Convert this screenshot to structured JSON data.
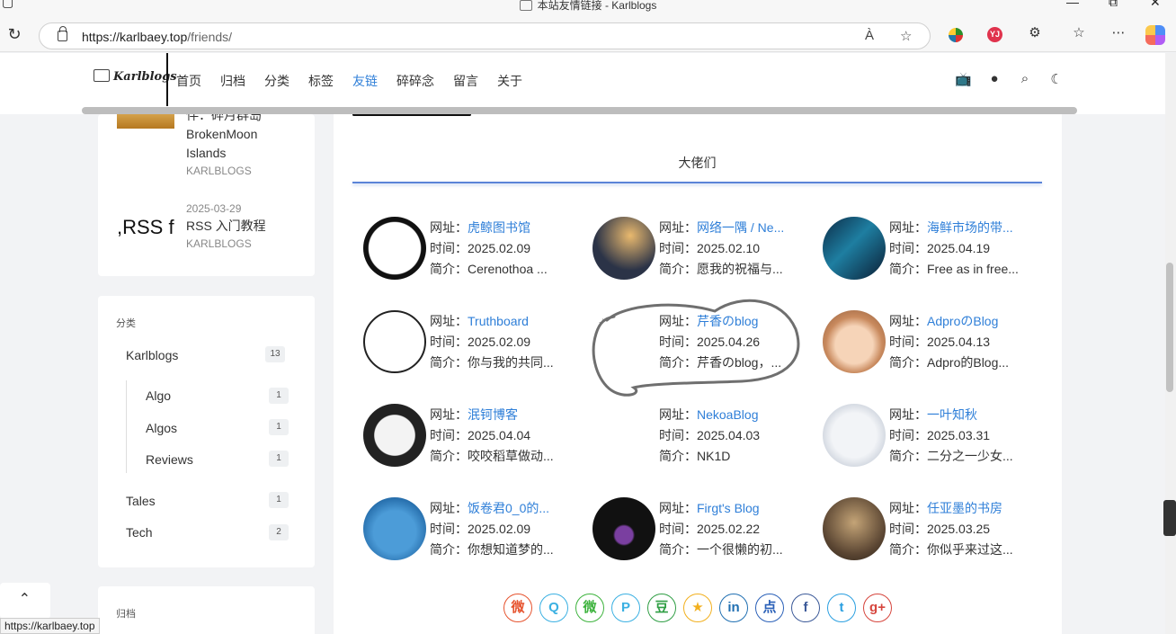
{
  "browser": {
    "window_title": "本站友情链接 - Karlblogs",
    "url_host": "https://karlbaey.top",
    "url_path": "/friends/",
    "read_aloud_icon": "À",
    "ext_badge": "YJ",
    "status_url": "https://karlbaey.top"
  },
  "site": {
    "logo_text": "Karlblogs",
    "nav": [
      {
        "label": "首页"
      },
      {
        "label": "归档"
      },
      {
        "label": "分类"
      },
      {
        "label": "标签"
      },
      {
        "label": "友链"
      },
      {
        "label": "碎碎念"
      },
      {
        "label": "留言"
      },
      {
        "label": "关于"
      }
    ]
  },
  "sidebar": {
    "recent_posts": [
      {
        "title_partial": "伴：碎月群岛",
        "title_line2": "BrokenMoon",
        "title_line3": "Islands",
        "author": "KARLBLOGS"
      },
      {
        "date": "2025-03-29",
        "title": "RSS 入门教程",
        "author": "KARLBLOGS",
        "thumb_text": ",RSS fe"
      }
    ],
    "categories_title": "分类",
    "categories": [
      {
        "name": "Karlblogs",
        "count": "13"
      },
      {
        "name": "Algo",
        "count": "1"
      },
      {
        "name": "Algos",
        "count": "1"
      },
      {
        "name": "Reviews",
        "count": "1"
      },
      {
        "name": "Tales",
        "count": "1"
      },
      {
        "name": "Tech",
        "count": "2"
      }
    ],
    "archive_title": "归档"
  },
  "main": {
    "heading": "大佬们",
    "label_url": "网址：",
    "label_time": "时间：",
    "label_desc": "简介：",
    "friends": [
      {
        "name": "虎鲸图书馆",
        "time": "2025.02.09",
        "desc": "Cerenothoa ..."
      },
      {
        "name": "网络一隅 / Ne...",
        "time": "2025.02.10",
        "desc": "愿我的祝福与..."
      },
      {
        "name": "海鲜市场的带...",
        "time": "2025.04.19",
        "desc": "Free as in free..."
      },
      {
        "name": "Truthboard",
        "time": "2025.02.09",
        "desc": "你与我的共同..."
      },
      {
        "name": "芹香のblog",
        "time": "2025.04.26",
        "desc": "芹香のblog，..."
      },
      {
        "name": "AdproのBlog",
        "time": "2025.04.13",
        "desc": "Adpro的Blog..."
      },
      {
        "name": "泯钶博客",
        "time": "2025.04.04",
        "desc": "咬咬稻草做动..."
      },
      {
        "name": "NekoaBlog",
        "time": "2025.04.03",
        "desc": "NK1D"
      },
      {
        "name": "一叶知秋",
        "time": "2025.03.31",
        "desc": "二分之一少女..."
      },
      {
        "name": "饭卷君0_0的...",
        "time": "2025.02.09",
        "desc": "你想知道梦的..."
      },
      {
        "name": "Firgt's Blog",
        "time": "2025.02.22",
        "desc": "一个很懒的初..."
      },
      {
        "name": "任亚墨的书房",
        "time": "2025.03.25",
        "desc": "你似乎来过这..."
      }
    ],
    "share": [
      {
        "glyph": "微",
        "color": "#e6532e"
      },
      {
        "glyph": "Q",
        "color": "#3ab0e2"
      },
      {
        "glyph": "微",
        "color": "#3db33d"
      },
      {
        "glyph": "P",
        "color": "#3ab0e2"
      },
      {
        "glyph": "豆",
        "color": "#2f9e44"
      },
      {
        "glyph": "★",
        "color": "#f2b01e"
      },
      {
        "glyph": "in",
        "color": "#1f6fb2"
      },
      {
        "glyph": "点",
        "color": "#2a60b8"
      },
      {
        "glyph": "f",
        "color": "#3b5998"
      },
      {
        "glyph": "t",
        "color": "#2a9fe0"
      },
      {
        "glyph": "g+",
        "color": "#d6453d"
      }
    ]
  }
}
